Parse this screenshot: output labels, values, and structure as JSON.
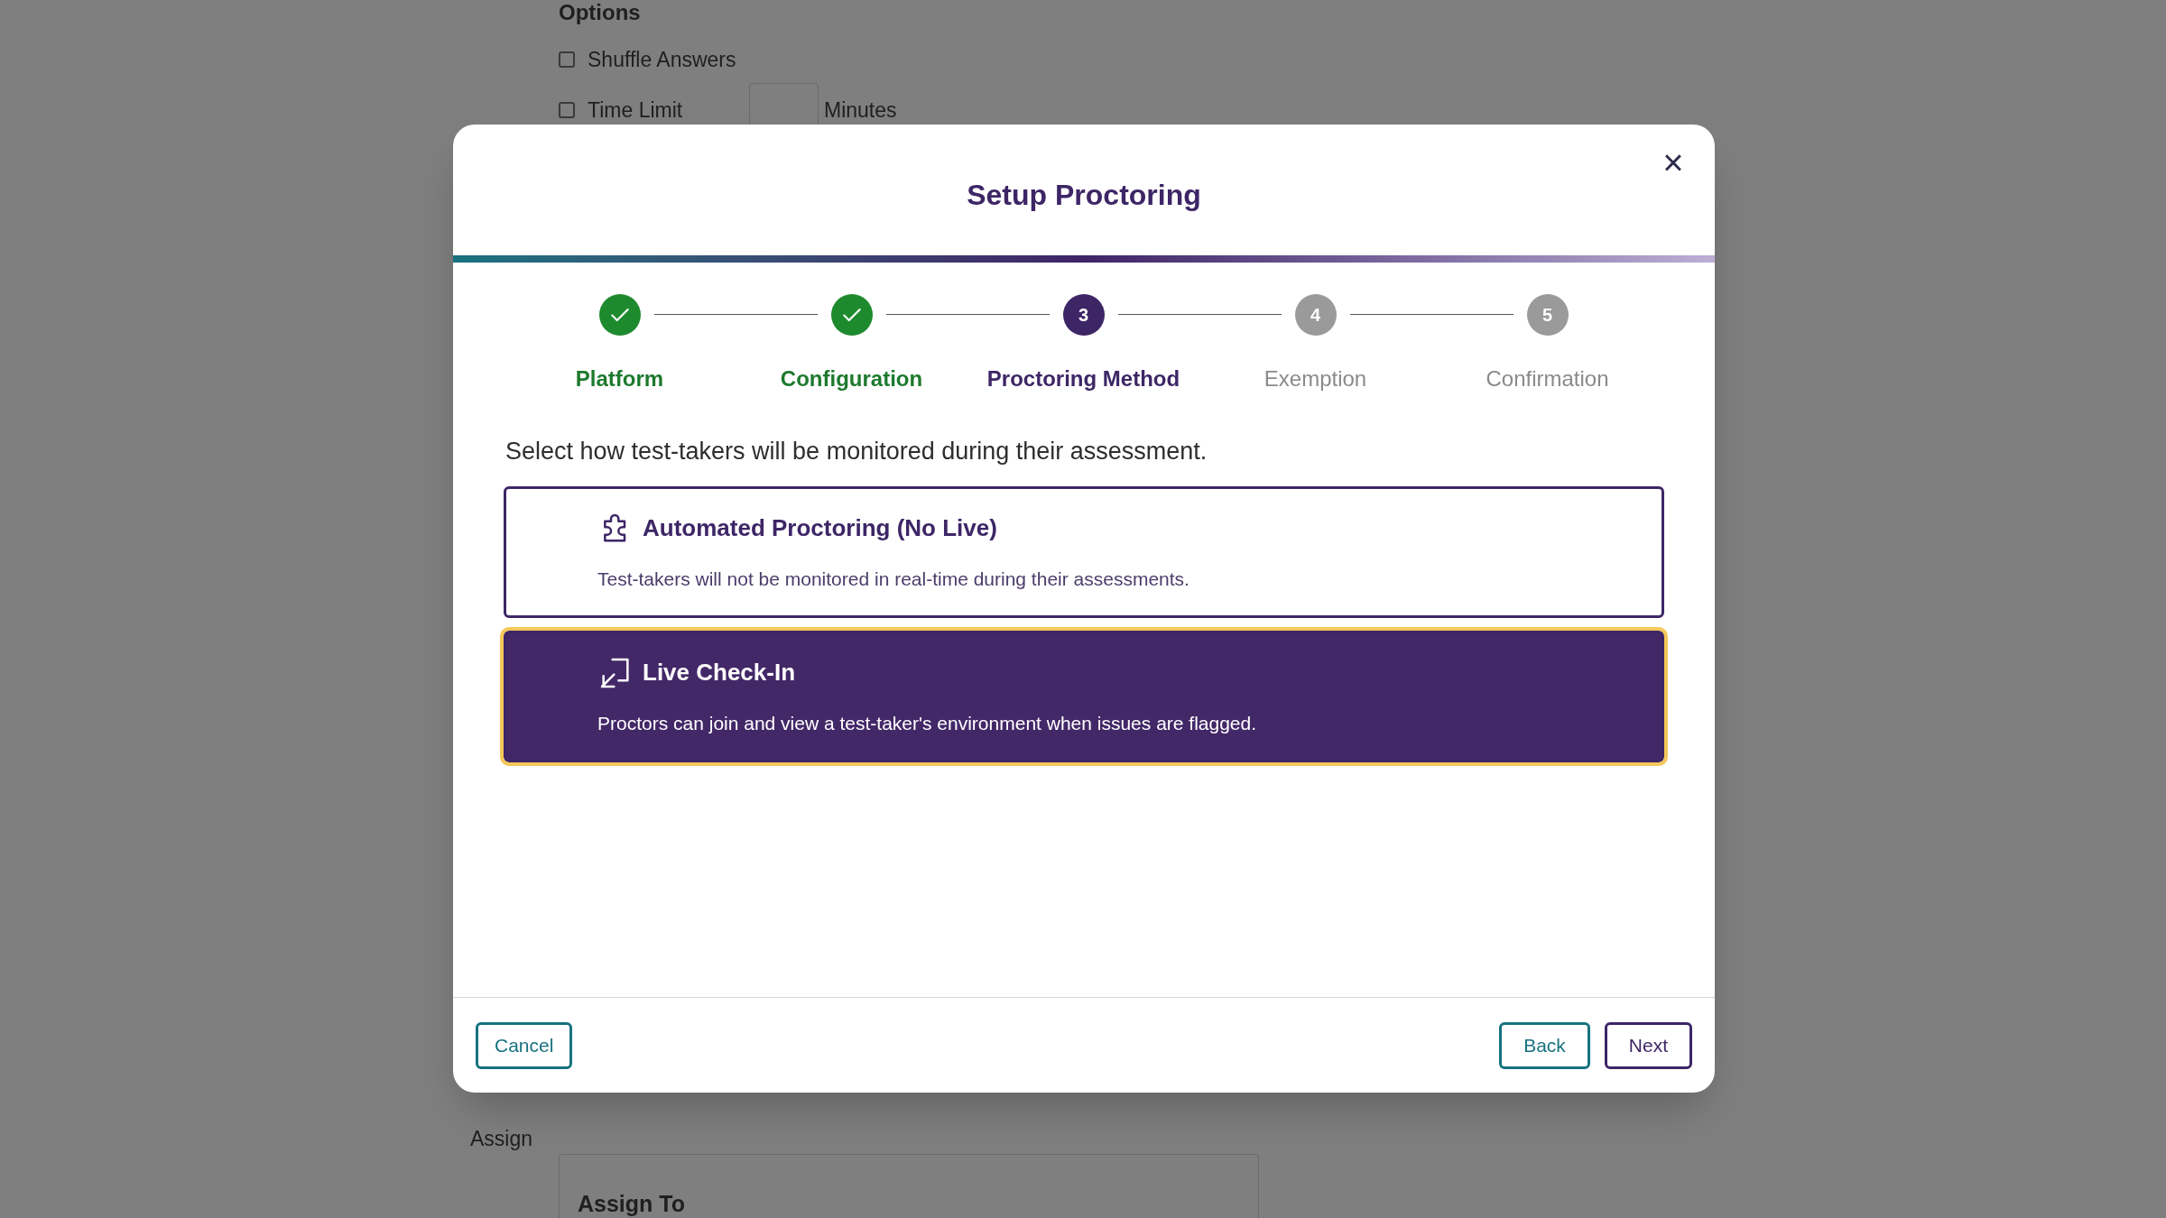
{
  "background": {
    "options_heading": "Options",
    "options": [
      {
        "label": "Shuffle Answers",
        "checked": false
      },
      {
        "label": "Time Limit",
        "checked": false
      }
    ],
    "time_limit_unit": "Minutes",
    "assign_label": "Assign",
    "assign_to_heading": "Assign To"
  },
  "dialog": {
    "title": "Setup Proctoring",
    "close": "×",
    "steps": [
      {
        "label": "Platform",
        "completed": true,
        "selected": false
      },
      {
        "label": "Configuration",
        "completed": true,
        "selected": false
      },
      {
        "label": "Proctoring Method",
        "number": "3",
        "completed": false,
        "selected": true
      },
      {
        "label": "Exemption",
        "number": "4",
        "completed": false,
        "selected": false
      },
      {
        "label": "Confirmation",
        "number": "5",
        "completed": false,
        "selected": false
      }
    ],
    "prompt": "Select how test-takers will be monitored during their assessment.",
    "options": [
      {
        "kind": "puzzle",
        "title": "Automated Proctoring (No Live)",
        "description": "Test-takers will not be monitored in real-time during their assessments.",
        "selected": false
      },
      {
        "kind": "join",
        "title": "Live Check-In",
        "description": "Proctors can join and view a test-taker's environment when issues are flagged.",
        "selected": true
      }
    ],
    "buttons": {
      "cancel": "Cancel",
      "back": "Back",
      "next": "Next"
    }
  }
}
